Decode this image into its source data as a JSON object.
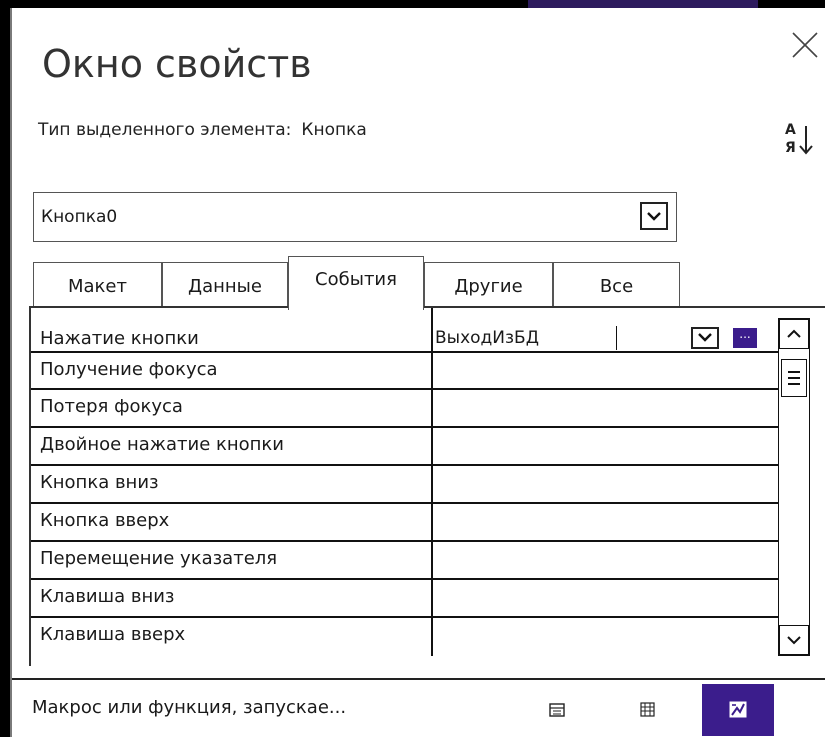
{
  "window": {
    "title": "Окно свойств",
    "selection_type_label": "Тип выделенного элемента:",
    "selection_type_value": "Кнопка"
  },
  "object_selector": {
    "value": "Кнопка0"
  },
  "tabs": [
    {
      "label": "Макет",
      "active": false
    },
    {
      "label": "Данные",
      "active": false
    },
    {
      "label": "События",
      "active": true
    },
    {
      "label": "Другие",
      "active": false
    },
    {
      "label": "Все",
      "active": false
    }
  ],
  "properties": [
    {
      "label": "Нажатие кнопки",
      "value": "ВыходИзБД"
    },
    {
      "label": "Получение фокуса",
      "value": ""
    },
    {
      "label": "Потеря фокуса",
      "value": ""
    },
    {
      "label": "Двойное нажатие кнопки",
      "value": ""
    },
    {
      "label": "Кнопка вниз",
      "value": ""
    },
    {
      "label": "Кнопка вверх",
      "value": ""
    },
    {
      "label": "Перемещение указателя",
      "value": ""
    },
    {
      "label": "Клавиша вниз",
      "value": ""
    },
    {
      "label": "Клавиша вверх",
      "value": ""
    }
  ],
  "builder_button_label": "...",
  "status_bar": {
    "text": "Макрос или функция, запускае...",
    "views": [
      {
        "icon": "form-view-icon",
        "active": false
      },
      {
        "icon": "datasheet-view-icon",
        "active": false
      },
      {
        "icon": "design-view-icon",
        "active": true
      }
    ]
  },
  "colors": {
    "accent": "#3b1d8c",
    "title_bar_accent": "#2d1b5e"
  }
}
